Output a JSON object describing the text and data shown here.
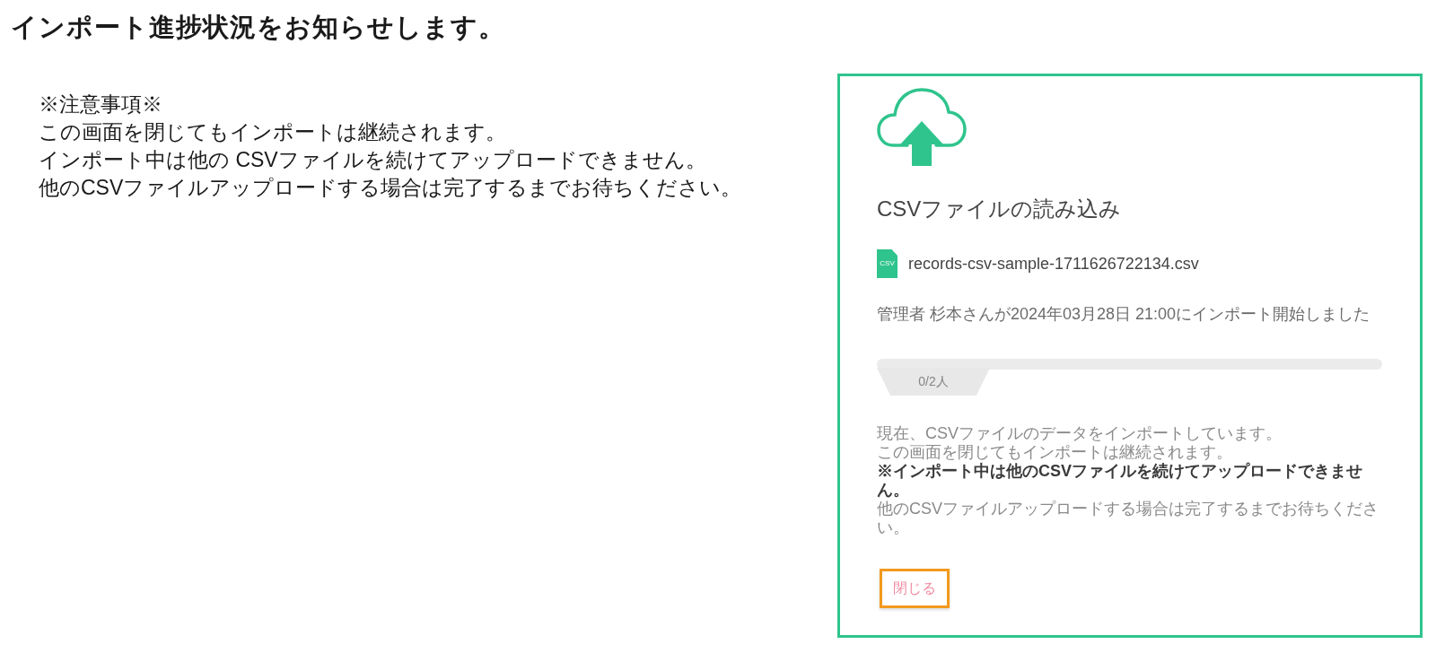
{
  "heading": "インポート進捗状況をお知らせします。",
  "notes": {
    "title": "※注意事項※",
    "lines": [
      "この画面を閉じてもインポートは継続されます。",
      "インポート中は他の CSVファイルを続けてアップロードできません。",
      "他のCSVファイルアップロードする場合は完了するまでお待ちください。"
    ]
  },
  "dialog": {
    "title": "CSVファイルの読み込み",
    "file": {
      "icon_label": "CSV",
      "name": "records-csv-sample-1711626722134.csv"
    },
    "started_message": "管理者 杉本さんが2024年03月28日 21:00にインポート開始しました",
    "progress": {
      "level": 0,
      "label": "0/2人"
    },
    "message_lines": [
      "現在、CSVファイルのデータをインポートしています。",
      "この画面を閉じてもインポートは継続されます。",
      "**※インポート中は他のCSVファイルを続けてアップロードできませ**",
      "**ん。**",
      "他のCSVファイルアップロードする場合は完了するまでお待ちくださ",
      "い。"
    ],
    "close_button": {
      "label": "閉じる",
      "highlighted": true
    }
  }
}
